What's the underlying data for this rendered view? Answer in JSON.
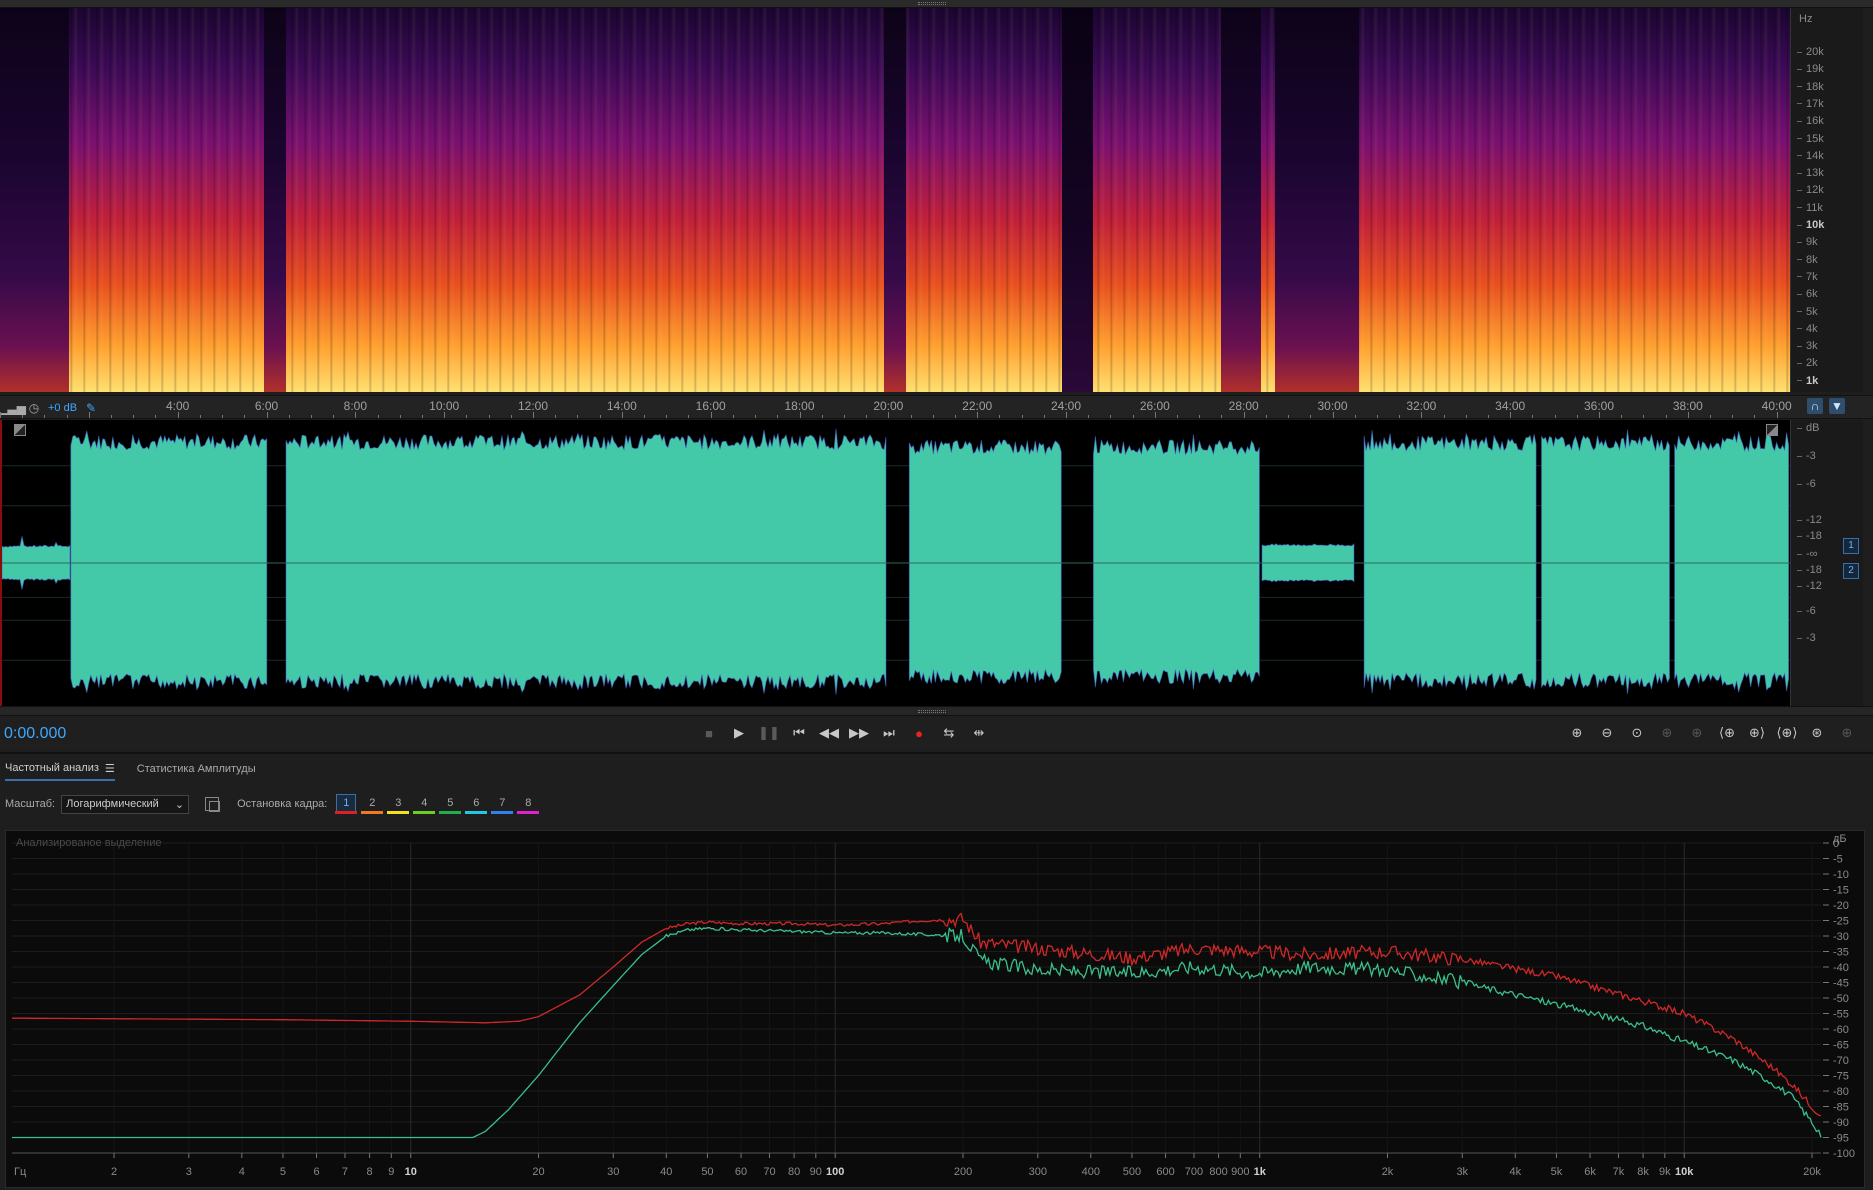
{
  "spectral": {
    "hz_unit": "Hz",
    "hz_labels": [
      "20k",
      "19k",
      "18k",
      "17k",
      "16k",
      "15k",
      "14k",
      "13k",
      "12k",
      "11k",
      "10k",
      "9k",
      "8k",
      "7k",
      "6k",
      "5k",
      "4k",
      "3k",
      "2k",
      "1k"
    ],
    "gaps": [
      {
        "from": 0,
        "to": 1.55,
        "full": false
      },
      {
        "from": 5.95,
        "to": 6.45,
        "full": false
      },
      {
        "from": 19.9,
        "to": 20.4,
        "full": false
      },
      {
        "from": 23.9,
        "to": 24.6,
        "full": true
      },
      {
        "from": 27.5,
        "to": 28.4,
        "full": false
      },
      {
        "from": 28.7,
        "to": 30.6,
        "full": false
      }
    ],
    "colormap": [
      "#1a0530",
      "#3a0a55",
      "#7a1070",
      "#c0203a",
      "#e85020",
      "#ffa030",
      "#ffe070"
    ]
  },
  "timeline": {
    "gain": "+0 dB",
    "labels": [
      "4:00",
      "6:00",
      "8:00",
      "10:00",
      "12:00",
      "14:00",
      "16:00",
      "18:00",
      "20:00",
      "22:00",
      "24:00",
      "26:00",
      "28:00",
      "30:00",
      "32:00",
      "34:00",
      "36:00",
      "38:00",
      "40:00"
    ],
    "icons": [
      "level-meter-icon",
      "clock-icon",
      "pin-icon"
    ]
  },
  "waveform": {
    "color": "#44c9a8",
    "edge_color": "#4a58d0",
    "db_labels_top": [
      "dB",
      "-3",
      "-6",
      "-12",
      "-18",
      "-∞"
    ],
    "db_labels_bottom": [
      "-18",
      "-12",
      "-6",
      "-3"
    ],
    "channels": [
      "1",
      "2"
    ],
    "total_minutes": 40.3,
    "segments": [
      {
        "from": 0,
        "to": 1.55,
        "amp": 0.13
      },
      {
        "from": 1.55,
        "to": 6.0,
        "amp": 0.94
      },
      {
        "from": 6.4,
        "to": 19.95,
        "amp": 0.94
      },
      {
        "from": 20.45,
        "to": 23.9,
        "amp": 0.9
      },
      {
        "from": 24.6,
        "to": 28.35,
        "amp": 0.9
      },
      {
        "from": 28.4,
        "to": 30.5,
        "amp": 0.14
      },
      {
        "from": 30.7,
        "to": 34.6,
        "amp": 0.93
      },
      {
        "from": 34.7,
        "to": 37.6,
        "amp": 0.93
      },
      {
        "from": 37.7,
        "to": 40.3,
        "amp": 0.93
      }
    ]
  },
  "transport": {
    "timecode": "0:00.000",
    "buttons": [
      {
        "name": "stop-button",
        "glyph": "■",
        "dim": true
      },
      {
        "name": "play-button",
        "glyph": "▶",
        "dim": false
      },
      {
        "name": "pause-button",
        "glyph": "❚❚",
        "dim": true
      },
      {
        "name": "go-to-start-button",
        "glyph": "⏮",
        "dim": false
      },
      {
        "name": "rewind-button",
        "glyph": "◀◀",
        "dim": false
      },
      {
        "name": "fast-forward-button",
        "glyph": "▶▶",
        "dim": false
      },
      {
        "name": "go-to-end-button",
        "glyph": "⏭",
        "dim": false
      },
      {
        "name": "record-button",
        "glyph": "●",
        "rec": true
      },
      {
        "name": "loop-button",
        "glyph": "⇆",
        "dim": false
      },
      {
        "name": "skip-selection-button",
        "glyph": "⇹",
        "dim": false
      }
    ],
    "zoom_buttons": [
      {
        "name": "zoom-in-amplitude-button",
        "glyph": "⊕",
        "dim": false
      },
      {
        "name": "zoom-out-amplitude-button",
        "glyph": "⊖",
        "dim": false
      },
      {
        "name": "zoom-reset-amplitude-button",
        "glyph": "⊙",
        "dim": false
      },
      {
        "name": "zoom-in-time-button",
        "glyph": "⊕",
        "dim": true
      },
      {
        "name": "zoom-out-time-button",
        "glyph": "⊕",
        "dim": true
      },
      {
        "name": "zoom-to-selection-start-button",
        "glyph": "⟨⊕",
        "dim": false
      },
      {
        "name": "zoom-to-selection-end-button",
        "glyph": "⊕⟩",
        "dim": false
      },
      {
        "name": "zoom-to-selection-button",
        "glyph": "⟨⊕⟩",
        "dim": false
      },
      {
        "name": "zoom-out-full-button",
        "glyph": "⊛",
        "dim": false
      },
      {
        "name": "zoom-selected-clips-button",
        "glyph": "⊕",
        "dim": true
      }
    ]
  },
  "panel": {
    "tabs": [
      {
        "label": "Частотный анализ",
        "active": true
      },
      {
        "label": "Статистика Амплитуды",
        "active": false
      }
    ],
    "scale_label": "Масштаб:",
    "scale_value": "Логарифмический",
    "hold_label": "Остановка кадра:",
    "hold_buttons": [
      {
        "label": "1",
        "color": "#e02020",
        "on": true
      },
      {
        "label": "2",
        "color": "#f07a20",
        "on": false
      },
      {
        "label": "3",
        "color": "#f0e020",
        "on": false
      },
      {
        "label": "4",
        "color": "#6ad020",
        "on": false
      },
      {
        "label": "5",
        "color": "#20b050",
        "on": false
      },
      {
        "label": "6",
        "color": "#20c8e0",
        "on": false
      },
      {
        "label": "7",
        "color": "#3080f0",
        "on": false
      },
      {
        "label": "8",
        "color": "#e020d0",
        "on": false
      }
    ],
    "analyzed_label": "Анализированое выделение"
  },
  "chart_data": {
    "type": "line",
    "title": "",
    "xlabel": "Гц",
    "ylabel": "дБ",
    "x_scale": "log",
    "xlim": [
      1.15,
      21000
    ],
    "ylim": [
      -100,
      0
    ],
    "grid": true,
    "x_tick_labels": [
      {
        "v": 2,
        "t": "2"
      },
      {
        "v": 3,
        "t": "3"
      },
      {
        "v": 4,
        "t": "4"
      },
      {
        "v": 5,
        "t": "5"
      },
      {
        "v": 6,
        "t": "6"
      },
      {
        "v": 7,
        "t": "7"
      },
      {
        "v": 8,
        "t": "8"
      },
      {
        "v": 9,
        "t": "9"
      },
      {
        "v": 10,
        "t": "10",
        "major": true
      },
      {
        "v": 20,
        "t": "20"
      },
      {
        "v": 30,
        "t": "30"
      },
      {
        "v": 40,
        "t": "40"
      },
      {
        "v": 50,
        "t": "50"
      },
      {
        "v": 60,
        "t": "60"
      },
      {
        "v": 70,
        "t": "70"
      },
      {
        "v": 80,
        "t": "80"
      },
      {
        "v": 90,
        "t": "90"
      },
      {
        "v": 100,
        "t": "100",
        "major": true
      },
      {
        "v": 200,
        "t": "200"
      },
      {
        "v": 300,
        "t": "300"
      },
      {
        "v": 400,
        "t": "400"
      },
      {
        "v": 500,
        "t": "500"
      },
      {
        "v": 600,
        "t": "600"
      },
      {
        "v": 700,
        "t": "700"
      },
      {
        "v": 800,
        "t": "800"
      },
      {
        "v": 900,
        "t": "900"
      },
      {
        "v": 1000,
        "t": "1k",
        "major": true
      },
      {
        "v": 2000,
        "t": "2k"
      },
      {
        "v": 3000,
        "t": "3k"
      },
      {
        "v": 4000,
        "t": "4k"
      },
      {
        "v": 5000,
        "t": "5k"
      },
      {
        "v": 6000,
        "t": "6k"
      },
      {
        "v": 7000,
        "t": "7k"
      },
      {
        "v": 8000,
        "t": "8k"
      },
      {
        "v": 9000,
        "t": "9k"
      },
      {
        "v": 10000,
        "t": "10k",
        "major": true
      },
      {
        "v": 20000,
        "t": "20k"
      }
    ],
    "y_ticks": [
      0,
      -5,
      -10,
      -15,
      -20,
      -25,
      -30,
      -35,
      -40,
      -45,
      -50,
      -55,
      -60,
      -65,
      -70,
      -75,
      -80,
      -85,
      -90,
      -95,
      -100
    ],
    "series": [
      {
        "color": "#d02828",
        "x": [
          1.15,
          5,
          10,
          15,
          18,
          20,
          25,
          30,
          35,
          40,
          45,
          50,
          60,
          80,
          100,
          130,
          160,
          200,
          220,
          300,
          500,
          700,
          1000,
          1300,
          2000,
          3000,
          5000,
          8000,
          10000,
          13000,
          16000,
          18000,
          20000,
          21000
        ],
        "y": [
          -56.5,
          -57,
          -57.5,
          -58,
          -57.5,
          -56,
          -49,
          -40,
          -32,
          -27.5,
          -26,
          -25.5,
          -26,
          -26,
          -26.5,
          -26,
          -25,
          -24.5,
          -32,
          -34,
          -37,
          -34,
          -35,
          -36,
          -35,
          -37.5,
          -43,
          -51,
          -55,
          -63,
          -72,
          -78,
          -85,
          -88
        ]
      },
      {
        "color": "#3ac08a",
        "x": [
          1.15,
          5,
          10,
          14,
          15,
          17,
          20,
          25,
          30,
          35,
          40,
          45,
          50,
          60,
          80,
          100,
          130,
          160,
          200,
          220,
          300,
          500,
          700,
          1000,
          1300,
          2000,
          3000,
          5000,
          8000,
          10000,
          13000,
          16000,
          18000,
          20000,
          21000
        ],
        "y": [
          -95,
          -95,
          -95,
          -95,
          -93,
          -86,
          -75,
          -58,
          -46,
          -36,
          -30,
          -28,
          -27.5,
          -28,
          -28.5,
          -29,
          -29,
          -29.5,
          -30,
          -38,
          -41,
          -42,
          -40,
          -42,
          -40,
          -41,
          -45,
          -52,
          -59,
          -64,
          -70,
          -77,
          -82,
          -90,
          -95
        ]
      }
    ]
  }
}
